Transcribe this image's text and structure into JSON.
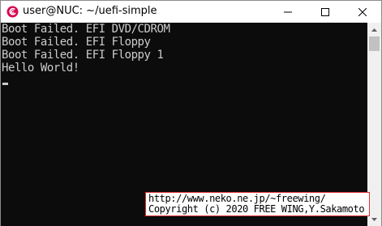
{
  "window": {
    "title": "user@NUC: ~/uefi-simple",
    "icon": "debian-swirl-icon",
    "accent": "#d70a53"
  },
  "console": {
    "background": "#0c0c0c",
    "foreground": "#cccccc",
    "lines": [
      "Boot Failed. EFI DVD/CDROM",
      "Boot Failed. EFI Floppy",
      "Boot Failed. EFI Floppy 1",
      "Hello World!"
    ]
  },
  "watermark": {
    "url": "http://www.neko.ne.jp/~freewing/",
    "copyright": "Copyright (c) 2020 FREE WING,Y.Sakamoto",
    "border_color": "#e03030"
  }
}
